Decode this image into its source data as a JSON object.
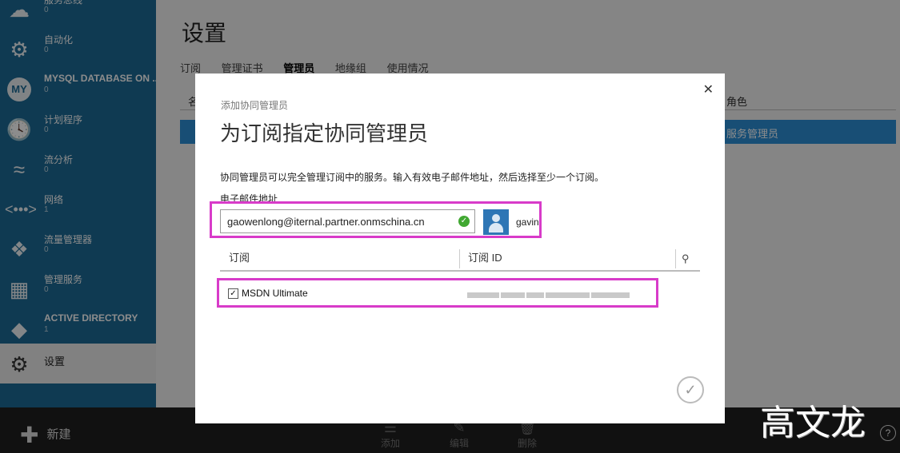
{
  "sidebar": {
    "items": [
      {
        "label": "服务总线",
        "count": "0",
        "icon": "bus-icon"
      },
      {
        "label": "自动化",
        "count": "0",
        "icon": "automation-gear-icon"
      },
      {
        "label": "MYSQL DATABASE ON ...",
        "count": "0",
        "icon": "mysql-icon"
      },
      {
        "label": "计划程序",
        "count": "0",
        "icon": "clock-icon"
      },
      {
        "label": "流分析",
        "count": "0",
        "icon": "stream-icon"
      },
      {
        "label": "网络",
        "count": "1",
        "icon": "network-icon"
      },
      {
        "label": "流量管理器",
        "count": "0",
        "icon": "traffic-icon"
      },
      {
        "label": "管理服务",
        "count": "0",
        "icon": "management-icon"
      },
      {
        "label": "ACTIVE DIRECTORY",
        "count": "1",
        "icon": "diamond-icon"
      },
      {
        "label": "设置",
        "count": "",
        "icon": "gear-icon"
      }
    ]
  },
  "page": {
    "title": "设置",
    "tabs": [
      "订阅",
      "管理证书",
      "管理员",
      "地缘组",
      "使用情况"
    ],
    "grid_col_name": "名",
    "grid_col_role": "角色",
    "grid_row_role": "服务管理员"
  },
  "bottom": {
    "new_label": "新建",
    "commands": [
      "添加",
      "编辑",
      "删除"
    ]
  },
  "dialog": {
    "subtitle": "添加协同管理员",
    "title": "为订阅指定协同管理员",
    "description": "协同管理员可以完全管理订阅中的服务。输入有效电子邮件地址，然后选择至少一个订阅。",
    "email_label": "电子邮件地址",
    "email_value": "gaowenlong@iternal.partner.onmschina.cn",
    "user_name": "gavin",
    "col_subscription": "订阅",
    "col_subscription_id": "订阅 ID",
    "subscriptions": [
      {
        "name": "MSDN Ultimate",
        "checked": true
      }
    ]
  },
  "watermark": "高文龙",
  "colors": {
    "sidebar": "#1d6a95",
    "highlight": "#d83bc9",
    "selected_row": "#2d8ed6"
  }
}
